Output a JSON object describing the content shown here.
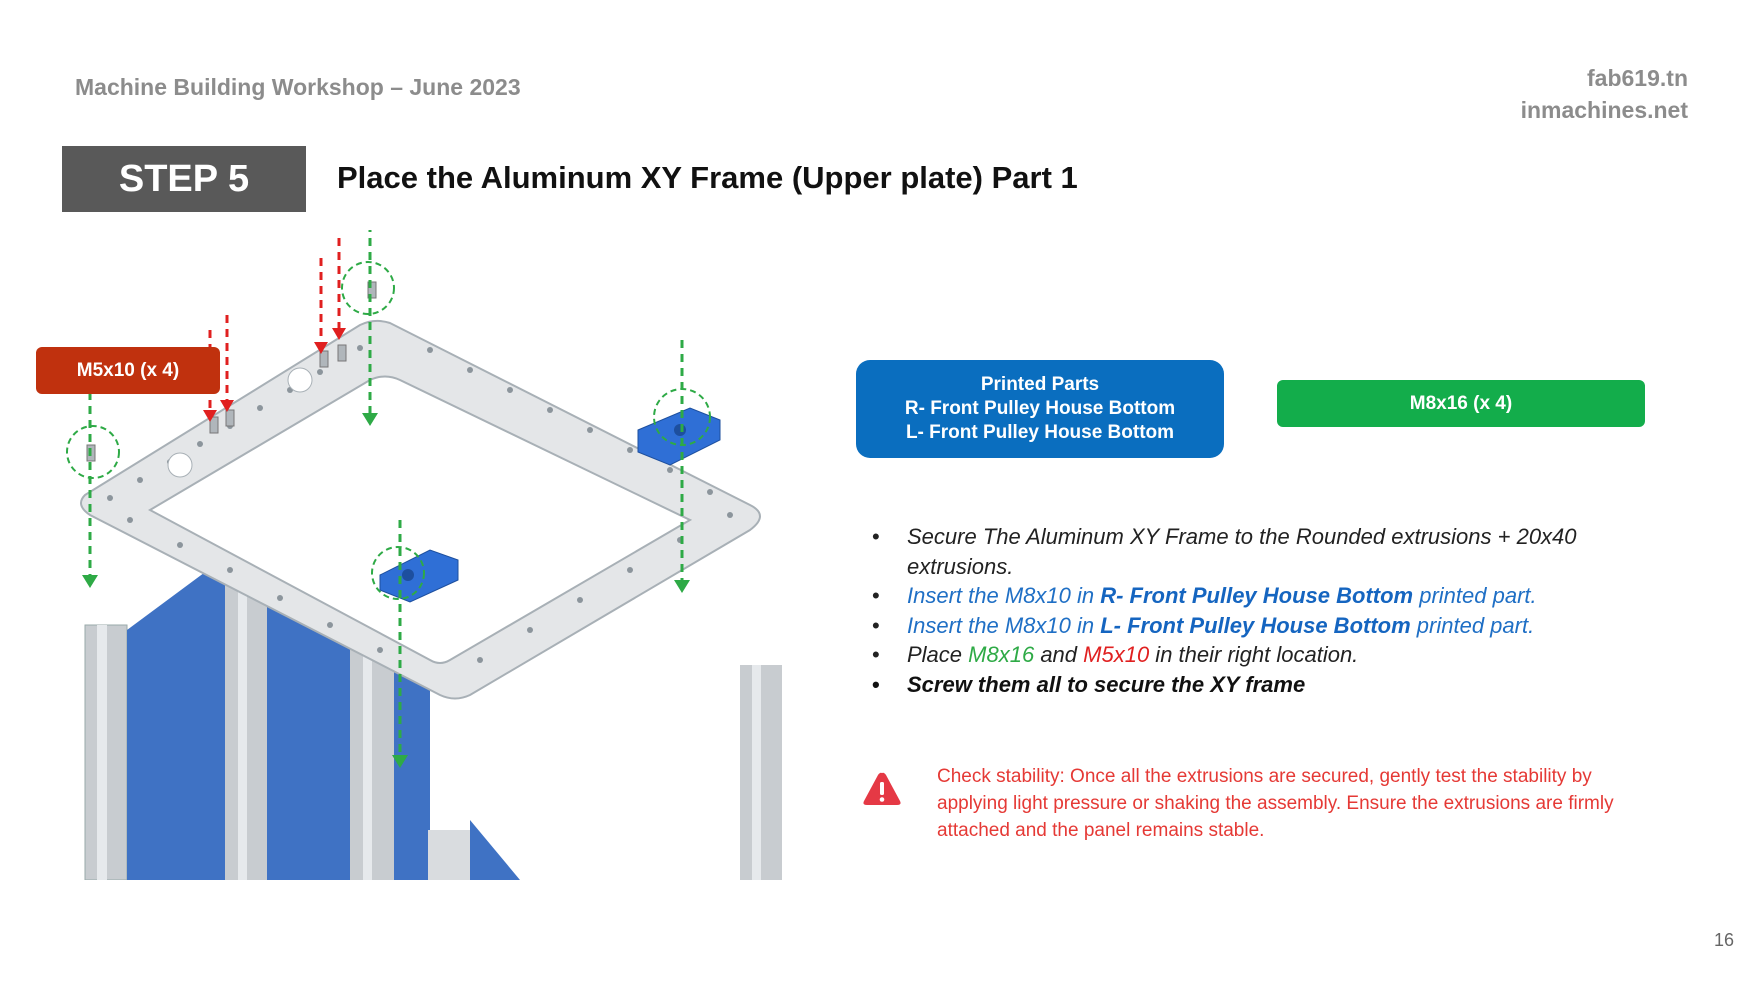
{
  "header": {
    "workshop": "Machine Building Workshop – June 2023",
    "site1": "fab619.tn",
    "site2": "inmachines.net"
  },
  "step": {
    "label": "STEP 5",
    "title": "Place the Aluminum XY Frame (Upper plate) Part 1"
  },
  "tags": {
    "m5": "M5x10 (x 4)",
    "printed_title": "Printed Parts",
    "printed_r": "R- Front Pulley House Bottom",
    "printed_l": "L- Front Pulley House Bottom",
    "m8": "M8x16 (x 4)"
  },
  "instructions": {
    "b1": "Secure The Aluminum XY Frame to the Rounded extrusions + 20x40 extrusions.",
    "b2_pre": "Insert the M8x10 in ",
    "b2_part": "R- Front Pulley House Bottom",
    "b2_post": " printed part.",
    "b3_pre": "Insert the M8x10 in ",
    "b3_part": "L- Front Pulley House Bottom",
    "b3_post": " printed part.",
    "b4_pre": "Place ",
    "b4_m8": "M8x16",
    "b4_mid": " and ",
    "b4_m5": "M5x10",
    "b4_post": " in their right location.",
    "b5": "Screw them all to secure the XY frame"
  },
  "warning": {
    "icon": "warning-triangle-icon",
    "text": "Check stability: Once all the extrusions are secured, gently test the stability by applying light pressure or shaking the assembly. Ensure the extrusions are firmly attached and the panel remains stable."
  },
  "page_number": "16",
  "colors": {
    "step_box": "#595959",
    "m5_tag": "#c0310e",
    "printed_tag": "#0a6ebf",
    "m8_tag": "#13ad4b",
    "warning": "#e53935"
  }
}
